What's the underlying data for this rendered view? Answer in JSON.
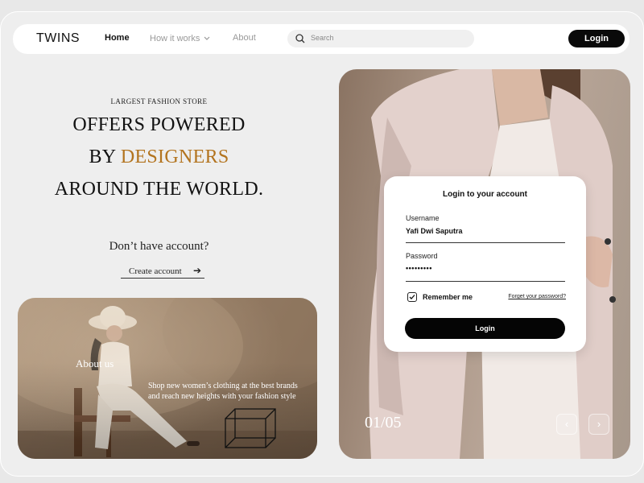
{
  "nav": {
    "logo": "TWINS",
    "links": [
      {
        "label": "Home",
        "active": true
      },
      {
        "label": "How it works",
        "has_dropdown": true
      },
      {
        "label": "About"
      }
    ],
    "search_placeholder": "Search",
    "login_label": "Login"
  },
  "hero": {
    "kicker": "LARGEST FASHION STORE",
    "line1": "OFFERS POWERED",
    "line2_prefix": "BY ",
    "line2_accent": "DESIGNERS",
    "line3": "AROUND THE WORLD.",
    "no_account": "Don’t have account?",
    "create_account": "Create account",
    "accent_color": "#b3741f"
  },
  "about": {
    "title": "About us",
    "description": "Shop new women’s clothing at the best brands and reach new heights with your fashion style"
  },
  "slider": {
    "counter": "01/05",
    "prev_icon": "chevron-left-icon",
    "next_icon": "chevron-right-icon"
  },
  "login_card": {
    "title": "Login to your account",
    "username_label": "Username",
    "username_value": "Yafi Dwi Saputra",
    "password_label": "Password",
    "password_value": "•••••••••",
    "remember_label": "Remember me",
    "remember_checked": true,
    "forgot_label": "Forget your password?",
    "submit_label": "Login"
  }
}
